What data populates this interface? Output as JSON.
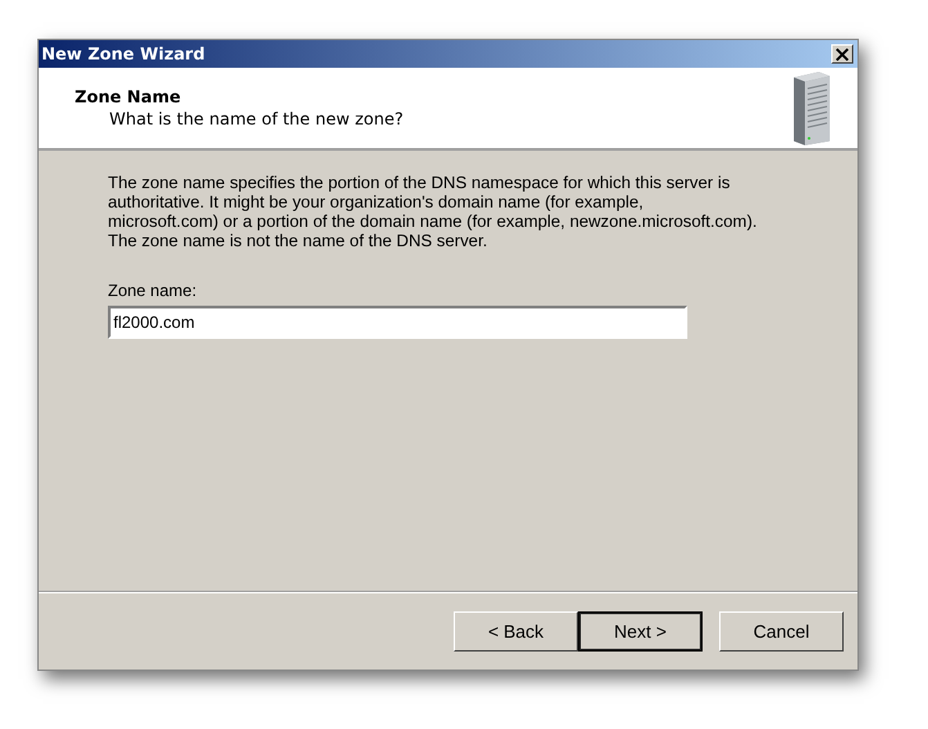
{
  "window": {
    "title": "New Zone Wizard"
  },
  "header": {
    "title": "Zone Name",
    "subtitle": "What is the name of the new zone?"
  },
  "description": "The zone name specifies the portion of the DNS namespace for which this server is authoritative. It might be your organization's domain name (for example,  microsoft.com) or a portion of the domain name (for example, newzone.microsoft.com). The zone name is not the name of the DNS server.",
  "zone_name": {
    "label": "Zone name:",
    "value": "fl2000.com"
  },
  "buttons": [
    {
      "label": "< Back",
      "default": false
    },
    {
      "label": "Next >",
      "default": true
    },
    {
      "label": "Cancel",
      "default": false
    }
  ]
}
